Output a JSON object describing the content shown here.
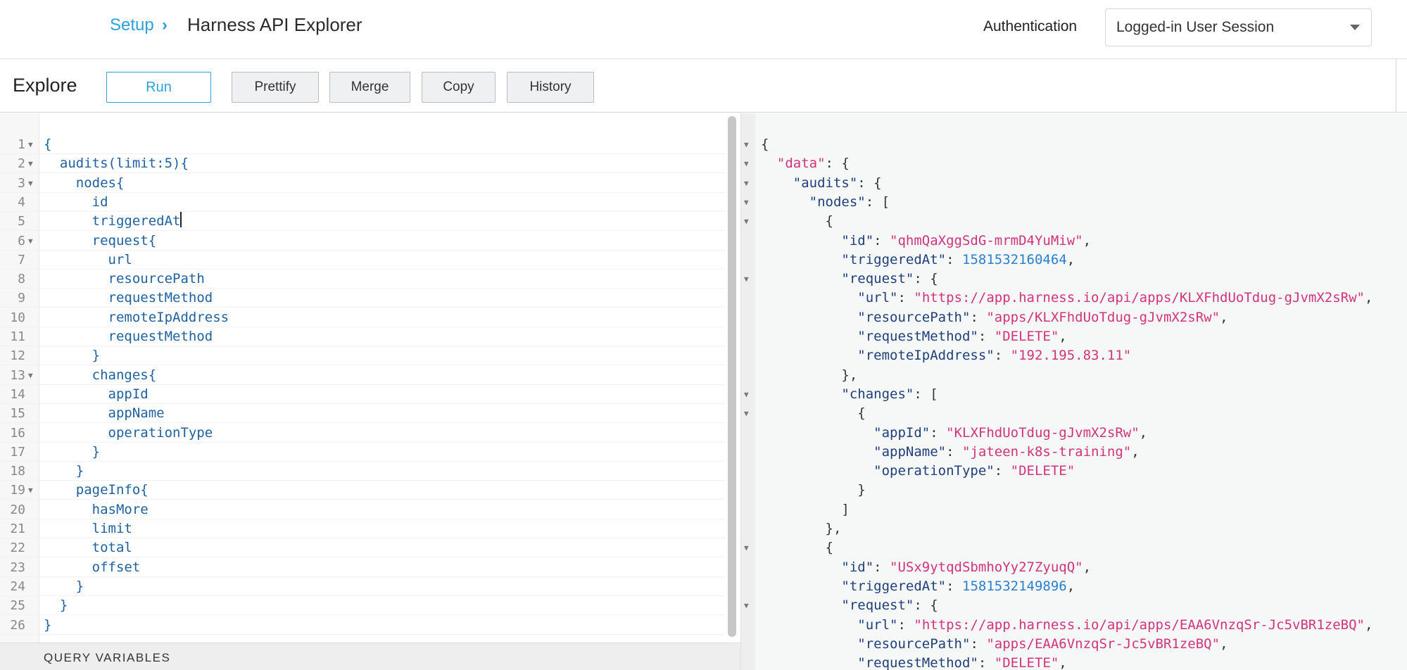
{
  "header": {
    "breadcrumb_root": "Setup",
    "title": "Harness API Explorer",
    "auth_label": "Authentication",
    "auth_value": "Logged-in User Session"
  },
  "toolbar": {
    "title": "Explore",
    "run": "Run",
    "prettify": "Prettify",
    "merge": "Merge",
    "copy": "Copy",
    "history": "History"
  },
  "editor": {
    "lines": [
      {
        "n": "1",
        "text": "{",
        "fold": true
      },
      {
        "n": "2",
        "text": "  audits(limit:5){",
        "fold": true
      },
      {
        "n": "3",
        "text": "    nodes{",
        "fold": true
      },
      {
        "n": "4",
        "text": "      id",
        "fold": false
      },
      {
        "n": "5",
        "text": "      triggeredAt",
        "fold": false,
        "cursor": true
      },
      {
        "n": "6",
        "text": "      request{",
        "fold": true
      },
      {
        "n": "7",
        "text": "        url",
        "fold": false
      },
      {
        "n": "8",
        "text": "        resourcePath",
        "fold": false
      },
      {
        "n": "9",
        "text": "        requestMethod",
        "fold": false
      },
      {
        "n": "10",
        "text": "        remoteIpAddress",
        "fold": false
      },
      {
        "n": "11",
        "text": "        requestMethod",
        "fold": false
      },
      {
        "n": "12",
        "text": "      }",
        "fold": false
      },
      {
        "n": "13",
        "text": "      changes{",
        "fold": true
      },
      {
        "n": "14",
        "text": "        appId",
        "fold": false
      },
      {
        "n": "15",
        "text": "        appName",
        "fold": false
      },
      {
        "n": "16",
        "text": "        operationType",
        "fold": false
      },
      {
        "n": "17",
        "text": "      }",
        "fold": false
      },
      {
        "n": "18",
        "text": "    }",
        "fold": false
      },
      {
        "n": "19",
        "text": "    pageInfo{",
        "fold": true
      },
      {
        "n": "20",
        "text": "      hasMore",
        "fold": false
      },
      {
        "n": "21",
        "text": "      limit",
        "fold": false
      },
      {
        "n": "22",
        "text": "      total",
        "fold": false
      },
      {
        "n": "23",
        "text": "      offset",
        "fold": false
      },
      {
        "n": "24",
        "text": "    }",
        "fold": false
      },
      {
        "n": "25",
        "text": "  }",
        "fold": false
      },
      {
        "n": "26",
        "text": "}",
        "fold": false
      }
    ],
    "query_variables_label": "QUERY VARIABLES"
  },
  "result": {
    "lines": [
      {
        "fold": true,
        "parts": [
          [
            "p",
            "{"
          ]
        ]
      },
      {
        "fold": true,
        "parts": [
          [
            "p",
            "  "
          ],
          [
            "s",
            "\"data\""
          ],
          [
            "p",
            ": {"
          ]
        ]
      },
      {
        "fold": true,
        "parts": [
          [
            "p",
            "    "
          ],
          [
            "k",
            "\"audits\""
          ],
          [
            "p",
            ": {"
          ]
        ]
      },
      {
        "fold": true,
        "parts": [
          [
            "p",
            "      "
          ],
          [
            "k",
            "\"nodes\""
          ],
          [
            "p",
            ": ["
          ]
        ]
      },
      {
        "fold": true,
        "parts": [
          [
            "p",
            "        {"
          ]
        ]
      },
      {
        "fold": false,
        "parts": [
          [
            "p",
            "          "
          ],
          [
            "k",
            "\"id\""
          ],
          [
            "p",
            ": "
          ],
          [
            "s",
            "\"qhmQaXggSdG-mrmD4YuMiw\""
          ],
          [
            "p",
            ","
          ]
        ]
      },
      {
        "fold": false,
        "parts": [
          [
            "p",
            "          "
          ],
          [
            "k",
            "\"triggeredAt\""
          ],
          [
            "p",
            ": "
          ],
          [
            "n",
            "1581532160464"
          ],
          [
            "p",
            ","
          ]
        ]
      },
      {
        "fold": true,
        "parts": [
          [
            "p",
            "          "
          ],
          [
            "k",
            "\"request\""
          ],
          [
            "p",
            ": {"
          ]
        ]
      },
      {
        "fold": false,
        "parts": [
          [
            "p",
            "            "
          ],
          [
            "k",
            "\"url\""
          ],
          [
            "p",
            ": "
          ],
          [
            "s",
            "\"https://app.harness.io/api/apps/KLXFhdUoTdug-gJvmX2sRw\""
          ],
          [
            "p",
            ","
          ]
        ]
      },
      {
        "fold": false,
        "parts": [
          [
            "p",
            "            "
          ],
          [
            "k",
            "\"resourcePath\""
          ],
          [
            "p",
            ": "
          ],
          [
            "s",
            "\"apps/KLXFhdUoTdug-gJvmX2sRw\""
          ],
          [
            "p",
            ","
          ]
        ]
      },
      {
        "fold": false,
        "parts": [
          [
            "p",
            "            "
          ],
          [
            "k",
            "\"requestMethod\""
          ],
          [
            "p",
            ": "
          ],
          [
            "s",
            "\"DELETE\""
          ],
          [
            "p",
            ","
          ]
        ]
      },
      {
        "fold": false,
        "parts": [
          [
            "p",
            "            "
          ],
          [
            "k",
            "\"remoteIpAddress\""
          ],
          [
            "p",
            ": "
          ],
          [
            "s",
            "\"192.195.83.11\""
          ]
        ]
      },
      {
        "fold": false,
        "parts": [
          [
            "p",
            "          },"
          ]
        ]
      },
      {
        "fold": true,
        "parts": [
          [
            "p",
            "          "
          ],
          [
            "k",
            "\"changes\""
          ],
          [
            "p",
            ": ["
          ]
        ]
      },
      {
        "fold": true,
        "parts": [
          [
            "p",
            "            {"
          ]
        ]
      },
      {
        "fold": false,
        "parts": [
          [
            "p",
            "              "
          ],
          [
            "k",
            "\"appId\""
          ],
          [
            "p",
            ": "
          ],
          [
            "s",
            "\"KLXFhdUoTdug-gJvmX2sRw\""
          ],
          [
            "p",
            ","
          ]
        ]
      },
      {
        "fold": false,
        "parts": [
          [
            "p",
            "              "
          ],
          [
            "k",
            "\"appName\""
          ],
          [
            "p",
            ": "
          ],
          [
            "s",
            "\"jateen-k8s-training\""
          ],
          [
            "p",
            ","
          ]
        ]
      },
      {
        "fold": false,
        "parts": [
          [
            "p",
            "              "
          ],
          [
            "k",
            "\"operationType\""
          ],
          [
            "p",
            ": "
          ],
          [
            "s",
            "\"DELETE\""
          ]
        ]
      },
      {
        "fold": false,
        "parts": [
          [
            "p",
            "            }"
          ]
        ]
      },
      {
        "fold": false,
        "parts": [
          [
            "p",
            "          ]"
          ]
        ]
      },
      {
        "fold": false,
        "parts": [
          [
            "p",
            "        },"
          ]
        ]
      },
      {
        "fold": true,
        "parts": [
          [
            "p",
            "        {"
          ]
        ]
      },
      {
        "fold": false,
        "parts": [
          [
            "p",
            "          "
          ],
          [
            "k",
            "\"id\""
          ],
          [
            "p",
            ": "
          ],
          [
            "s",
            "\"USx9ytqdSbmhoYy27ZyuqQ\""
          ],
          [
            "p",
            ","
          ]
        ]
      },
      {
        "fold": false,
        "parts": [
          [
            "p",
            "          "
          ],
          [
            "k",
            "\"triggeredAt\""
          ],
          [
            "p",
            ": "
          ],
          [
            "n",
            "1581532149896"
          ],
          [
            "p",
            ","
          ]
        ]
      },
      {
        "fold": true,
        "parts": [
          [
            "p",
            "          "
          ],
          [
            "k",
            "\"request\""
          ],
          [
            "p",
            ": {"
          ]
        ]
      },
      {
        "fold": false,
        "parts": [
          [
            "p",
            "            "
          ],
          [
            "k",
            "\"url\""
          ],
          [
            "p",
            ": "
          ],
          [
            "s",
            "\"https://app.harness.io/api/apps/EAA6VnzqSr-Jc5vBR1zeBQ\""
          ],
          [
            "p",
            ","
          ]
        ]
      },
      {
        "fold": false,
        "parts": [
          [
            "p",
            "            "
          ],
          [
            "k",
            "\"resourcePath\""
          ],
          [
            "p",
            ": "
          ],
          [
            "s",
            "\"apps/EAA6VnzqSr-Jc5vBR1zeBQ\""
          ],
          [
            "p",
            ","
          ]
        ]
      },
      {
        "fold": false,
        "parts": [
          [
            "p",
            "            "
          ],
          [
            "k",
            "\"requestMethod\""
          ],
          [
            "p",
            ": "
          ],
          [
            "s",
            "\"DELETE\""
          ],
          [
            "p",
            ","
          ]
        ]
      }
    ]
  }
}
